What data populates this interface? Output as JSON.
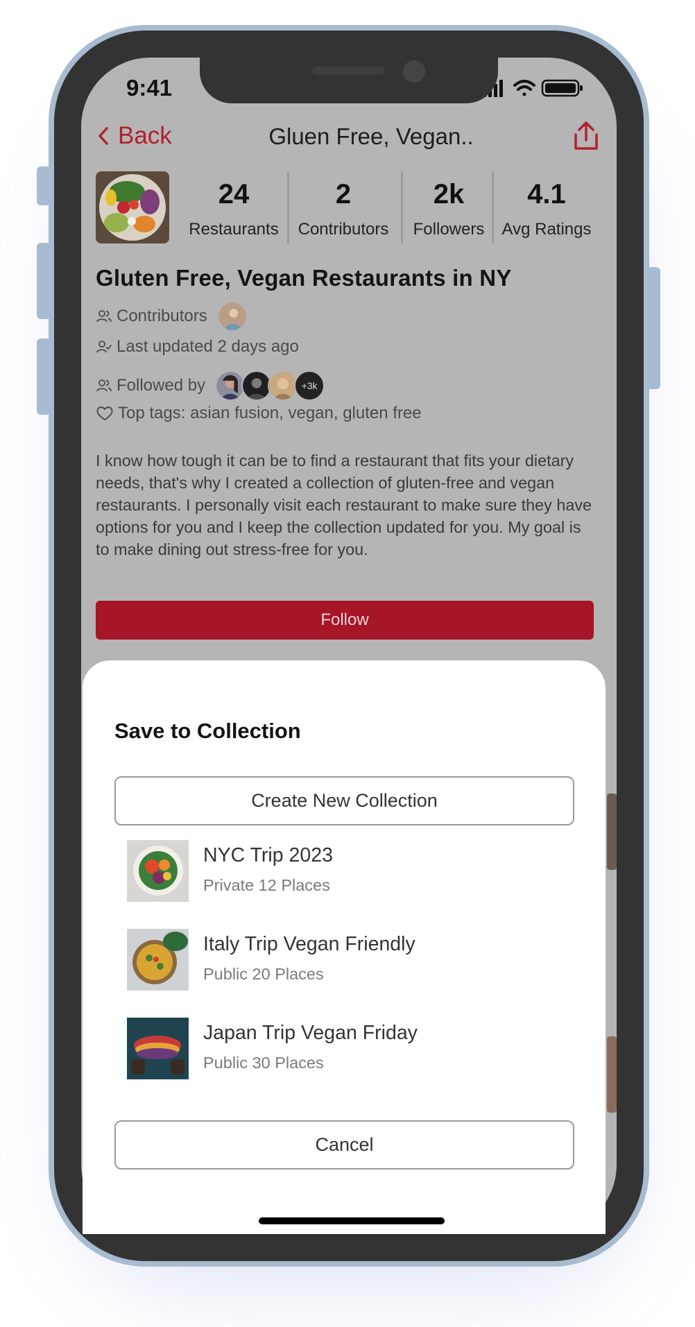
{
  "status_bar": {
    "time": "9:41"
  },
  "nav": {
    "back_label": "Back",
    "title": "Gluen Free, Vegan.."
  },
  "stats": [
    {
      "value": "24",
      "label": "Restaurants"
    },
    {
      "value": "2",
      "label": "Contributors"
    },
    {
      "value": "2k",
      "label": "Followers"
    },
    {
      "value": "4.1",
      "label": "Avg Ratings"
    }
  ],
  "collection": {
    "title": "Gluten Free, Vegan Restaurants in NY",
    "contributors_label": "Contributors",
    "last_updated": "Last updated 2 days ago",
    "followed_by_label": "Followed by",
    "followers_more": "+3k",
    "top_tags": "Top tags: asian fusion, vegan, gluten free",
    "description": "I know how tough it can be to find a restaurant that fits your dietary needs, that's why I created a collection of gluten-free and vegan restaurants. I personally visit each restaurant to make sure they have options for you and I keep the collection updated for you. My goal is to make dining out stress-free for you.",
    "follow_label": "Follow"
  },
  "sheet": {
    "title": "Save to Collection",
    "create_label": "Create New Collection",
    "items": [
      {
        "name": "NYC Trip 2023",
        "meta": "Private 12 Places"
      },
      {
        "name": "Italy Trip Vegan Friendly",
        "meta": "Public 20 Places"
      },
      {
        "name": "Japan Trip Vegan Friday",
        "meta": "Public 30 Places"
      }
    ],
    "cancel_label": "Cancel"
  },
  "colors": {
    "accent": "#b41f2e",
    "follow_button": "#a61626",
    "phone_frame": "#a8bbd0",
    "bezel": "#333333"
  },
  "icons": [
    "chevron-left-icon",
    "share-icon",
    "users-icon",
    "user-check-icon",
    "heart-icon",
    "signal-icon",
    "wifi-icon",
    "battery-icon"
  ]
}
